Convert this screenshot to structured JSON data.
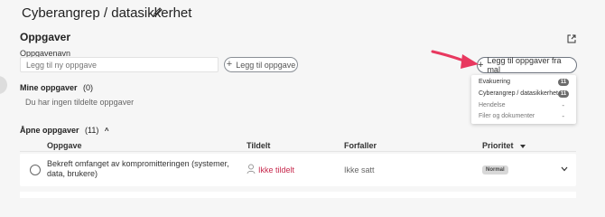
{
  "page": {
    "title": "Cyberangrep / datasikkerhet"
  },
  "tasks_section": {
    "title": "Oppgaver"
  },
  "task_form": {
    "label": "Oppgavenavn",
    "placeholder": "Legg til ny oppgave",
    "add_button": "Legg til oppgave",
    "template_button": "Legg til oppgaver fra mal"
  },
  "template_menu": {
    "items": [
      {
        "label": "Evakuering",
        "count": "11"
      },
      {
        "label": "Cyberangrep / datasikkerhet",
        "count": "11"
      },
      {
        "label": "Hendelse",
        "count": "-"
      },
      {
        "label": "Filer og dokumenter",
        "count": "-"
      }
    ]
  },
  "my_tasks": {
    "title": "Mine oppgaver",
    "count": "(0)",
    "empty_text": "Du har ingen tildelte oppgaver"
  },
  "open_tasks": {
    "title": "Åpne oppgaver",
    "count": "(11)"
  },
  "table": {
    "headers": {
      "task": "Oppgave",
      "assigned": "Tildelt",
      "due": "Forfaller",
      "priority": "Prioritet"
    },
    "rows": [
      {
        "task": "Bekreft omfanget av kompromitteringen (systemer, data, brukere)",
        "assigned": "Ikke tildelt",
        "due": "Ikke satt",
        "priority": "Normal"
      }
    ]
  },
  "colors": {
    "accent": "#c7284c",
    "arrow": "#e8385f"
  }
}
